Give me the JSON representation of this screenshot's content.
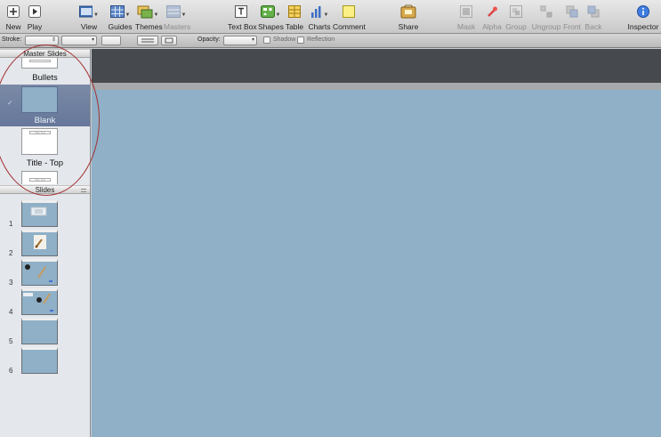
{
  "toolbar": {
    "new": "New",
    "play": "Play",
    "view": "View",
    "guides": "Guides",
    "themes": "Themes",
    "masters": "Masters",
    "text_box": "Text Box",
    "shapes": "Shapes",
    "table": "Table",
    "charts": "Charts",
    "comment": "Comment",
    "share": "Share",
    "mask": "Mask",
    "alpha": "Alpha",
    "group": "Group",
    "ungroup": "Ungroup",
    "front": "Front",
    "back": "Back",
    "inspector": "Inspector"
  },
  "format_bar": {
    "stroke_label": "Stroke:",
    "opacity_label": "Opacity:",
    "shadow_label": "Shadow",
    "reflection_label": "Reflection"
  },
  "sidebar": {
    "master_header": "Master Slides",
    "masters": [
      {
        "name": "Bullets"
      },
      {
        "name": "Blank",
        "selected": true
      },
      {
        "name": "Title - Top"
      }
    ],
    "slides_header": "Slides",
    "slides": [
      {
        "number": "1"
      },
      {
        "number": "2"
      },
      {
        "number": "3"
      },
      {
        "number": "4"
      },
      {
        "number": "5"
      },
      {
        "number": "6"
      }
    ]
  },
  "thumb_text": "Title Text",
  "colors": {
    "slide_background": "#8fb0c7",
    "selection": "#6e7fa0",
    "annotation": "#a33030"
  }
}
